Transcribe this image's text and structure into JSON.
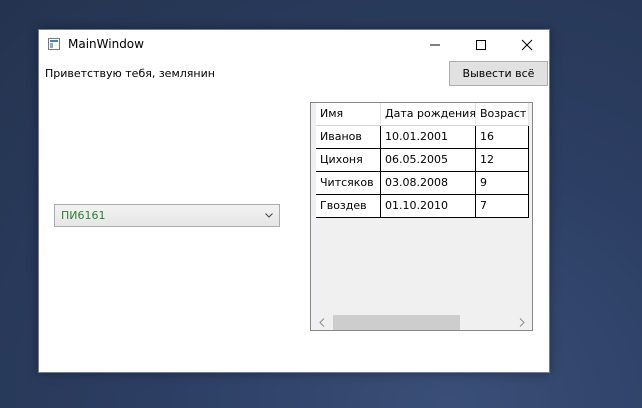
{
  "window": {
    "title": "MainWindow",
    "icons": {
      "app": "window-app-icon",
      "minimize": "minimize-icon",
      "maximize": "maximize-icon",
      "close": "close-icon"
    }
  },
  "main": {
    "greeting": "Приветствую тебя, землянин",
    "show_all_button": "Вывести всё",
    "combo": {
      "selected": "ПИ6161",
      "value_color": "#2e7d32"
    }
  },
  "grid": {
    "columns": [
      "Имя",
      "Дата рождения",
      "Возраст"
    ],
    "rows": [
      [
        "Иванов",
        "10.01.2001",
        "16"
      ],
      [
        "Цихоня",
        "06.05.2005",
        "12"
      ],
      [
        "Читсяков",
        "03.08.2008",
        "9"
      ],
      [
        "Гвоздев",
        "01.10.2010",
        "7"
      ]
    ]
  }
}
